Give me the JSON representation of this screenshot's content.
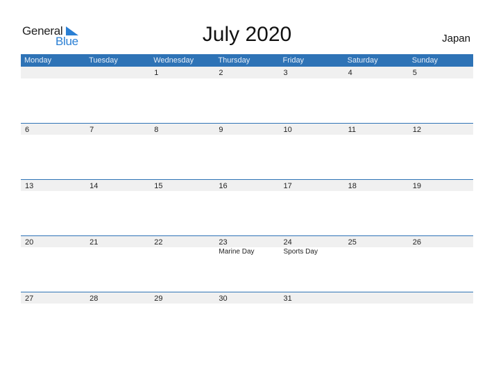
{
  "logo": {
    "word1": "General",
    "word2": "Blue"
  },
  "title": "July 2020",
  "country": "Japan",
  "weekdays": [
    "Monday",
    "Tuesday",
    "Wednesday",
    "Thursday",
    "Friday",
    "Saturday",
    "Sunday"
  ],
  "weeks": [
    {
      "days": [
        {
          "num": "",
          "holiday": ""
        },
        {
          "num": "",
          "holiday": ""
        },
        {
          "num": "1",
          "holiday": ""
        },
        {
          "num": "2",
          "holiday": ""
        },
        {
          "num": "3",
          "holiday": ""
        },
        {
          "num": "4",
          "holiday": ""
        },
        {
          "num": "5",
          "holiday": ""
        }
      ]
    },
    {
      "days": [
        {
          "num": "6",
          "holiday": ""
        },
        {
          "num": "7",
          "holiday": ""
        },
        {
          "num": "8",
          "holiday": ""
        },
        {
          "num": "9",
          "holiday": ""
        },
        {
          "num": "10",
          "holiday": ""
        },
        {
          "num": "11",
          "holiday": ""
        },
        {
          "num": "12",
          "holiday": ""
        }
      ]
    },
    {
      "days": [
        {
          "num": "13",
          "holiday": ""
        },
        {
          "num": "14",
          "holiday": ""
        },
        {
          "num": "15",
          "holiday": ""
        },
        {
          "num": "16",
          "holiday": ""
        },
        {
          "num": "17",
          "holiday": ""
        },
        {
          "num": "18",
          "holiday": ""
        },
        {
          "num": "19",
          "holiday": ""
        }
      ]
    },
    {
      "days": [
        {
          "num": "20",
          "holiday": ""
        },
        {
          "num": "21",
          "holiday": ""
        },
        {
          "num": "22",
          "holiday": ""
        },
        {
          "num": "23",
          "holiday": "Marine Day"
        },
        {
          "num": "24",
          "holiday": "Sports Day"
        },
        {
          "num": "25",
          "holiday": ""
        },
        {
          "num": "26",
          "holiday": ""
        }
      ]
    },
    {
      "days": [
        {
          "num": "27",
          "holiday": ""
        },
        {
          "num": "28",
          "holiday": ""
        },
        {
          "num": "29",
          "holiday": ""
        },
        {
          "num": "30",
          "holiday": ""
        },
        {
          "num": "31",
          "holiday": ""
        },
        {
          "num": "",
          "holiday": ""
        },
        {
          "num": "",
          "holiday": ""
        }
      ]
    }
  ],
  "colors": {
    "accent": "#2e73b6",
    "logo_blue": "#2a7fd4",
    "band": "#f0f0f0"
  }
}
